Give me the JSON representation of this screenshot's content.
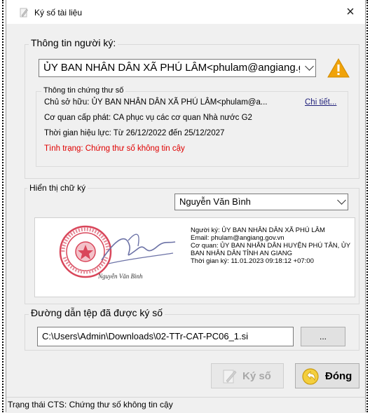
{
  "window": {
    "title": "Ký số tài liệu",
    "close_glyph": "×"
  },
  "signer": {
    "legend": "Thông tin người ký:",
    "selected": "ỦY BAN NHÂN DÂN XÃ PHÚ LÂM<phulam@angiang.gov.vn>",
    "warning_icon": "warning-icon",
    "cert": {
      "legend": "Thông tin chứng thư số",
      "owner": "Chủ sở hữu: ỦY BAN NHÂN DÂN XÃ PHÚ LÂM<phulam@a...",
      "details_link": "Chi tiết...",
      "issuer": "Cơ quan cấp phát: CA phục vụ các cơ quan Nhà nước G2",
      "validity": "Thời gian hiệu lực: Từ 26/12/2022 đến 25/12/2027",
      "status": "Tình trạng: Chứng thư số không tin cậy",
      "status_color": "#e00000"
    }
  },
  "display": {
    "legend": "Hiển thị chữ ký",
    "selected_name": "Nguyễn Văn Bình",
    "preview": {
      "signature_caption": "Nguyễn Văn Bình",
      "signer_line": "Người ký: ỦY BAN NHÂN DÂN XÃ PHÚ LÂM",
      "email_line": "Email: phulam@angiang.gov.vn",
      "org_line": "Cơ quan: ỦY BAN NHÂN DÂN HUYỆN PHÚ TÂN, ỦY BAN NHÂN DÂN TỈNH AN GIANG",
      "time_line": "Thời gian ký: 11.01.2023 09:18:12 +07:00"
    }
  },
  "output": {
    "legend": "Đường dẫn tệp đã được ký số",
    "path_value": "C:\\Users\\Admin\\Downloads\\02-TTr-CAT-PC06_1.si",
    "browse_label": "..."
  },
  "buttons": {
    "sign_label": "Ký số",
    "close_label": "Đóng"
  },
  "statusbar": {
    "text": "Trạng thái CTS: Chứng thư số không tin cậy"
  }
}
